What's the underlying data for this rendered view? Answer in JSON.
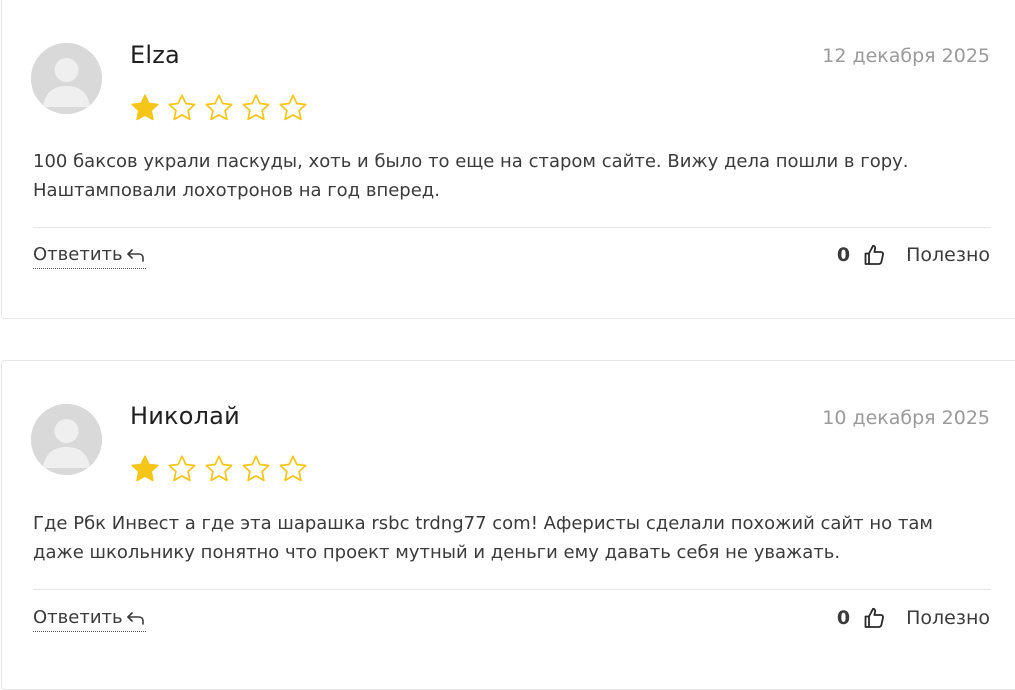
{
  "reviews": [
    {
      "author": "Elza",
      "date": "12 декабря 2025",
      "rating": 1,
      "max_rating": 5,
      "text_line1": "100 баксов украли паскуды, хоть и было то еще на старом сайте. Вижу дела пошли в гору.",
      "text_line2": "Наштамповали лохотронов на год вперед.",
      "reply_label": "Ответить",
      "helpful_count": "0",
      "helpful_label": "Полезно"
    },
    {
      "author": "Николай",
      "date": "10 декабря 2025",
      "rating": 1,
      "max_rating": 5,
      "text_line1": "Где Рбк Инвест а где эта шарашка rsbc trdng77 com! Аферисты сделали похожий сайт но там",
      "text_line2": "даже школьнику понятно что проект мутный и деньги ему давать себя не уважать.",
      "reply_label": "Ответить",
      "helpful_count": "0",
      "helpful_label": "Полезно"
    }
  ],
  "colors": {
    "star_filled": "#f5c518",
    "star_outline": "#f5c518",
    "avatar_bg": "#d9d9d9",
    "date": "#9a9a9a"
  },
  "icons": {
    "avatar": "user-placeholder-icon",
    "star": "star-icon",
    "reply": "reply-arrow-icon",
    "thumb": "thumbs-up-icon"
  }
}
